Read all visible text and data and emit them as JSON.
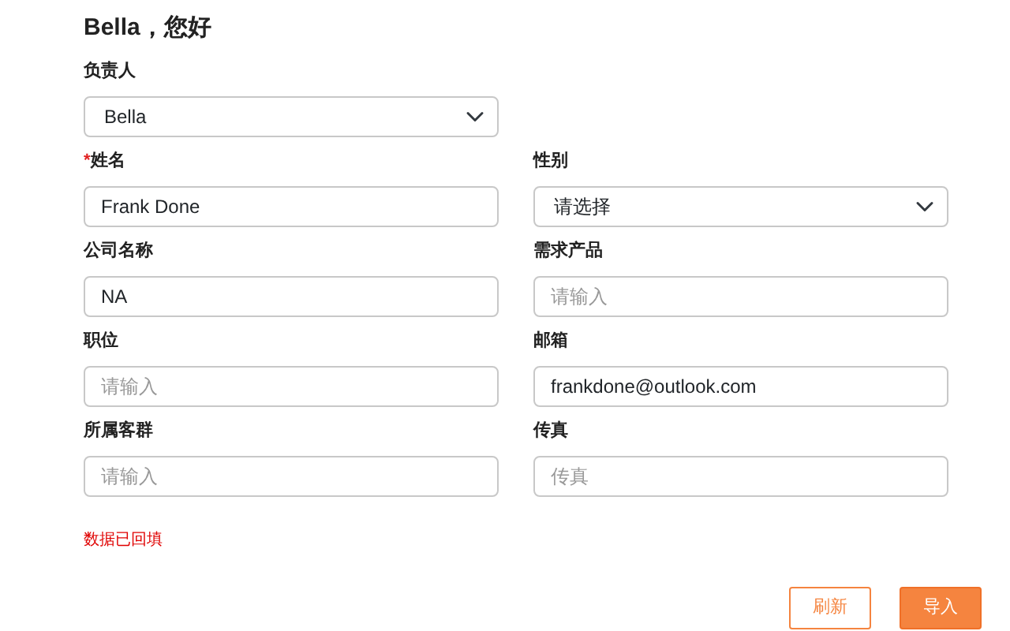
{
  "greeting": "Bella，您好",
  "rows": [
    [
      {
        "kind": "select",
        "label": "负责人",
        "value": "Bella"
      }
    ],
    [
      {
        "kind": "input",
        "label": "姓名",
        "required_mark": "*",
        "value": "Frank Done"
      },
      {
        "kind": "select",
        "label": "性别",
        "value": "请选择"
      }
    ],
    [
      {
        "kind": "input",
        "label": "公司名称",
        "value": "NA"
      },
      {
        "kind": "input",
        "label": "需求产品",
        "placeholder": "请输入"
      }
    ],
    [
      {
        "kind": "input",
        "label": "职位",
        "placeholder": "请输入"
      },
      {
        "kind": "input",
        "label": "邮箱",
        "value": "frankdone@outlook.com"
      }
    ],
    [
      {
        "kind": "input",
        "label": "所属客群",
        "placeholder": "请输入"
      },
      {
        "kind": "input",
        "label": "传真",
        "placeholder": "传真"
      }
    ]
  ],
  "message": "数据已回填",
  "buttons": [
    {
      "label": "刷新",
      "kind": "outline"
    },
    {
      "label": "导入",
      "kind": "primary"
    }
  ]
}
